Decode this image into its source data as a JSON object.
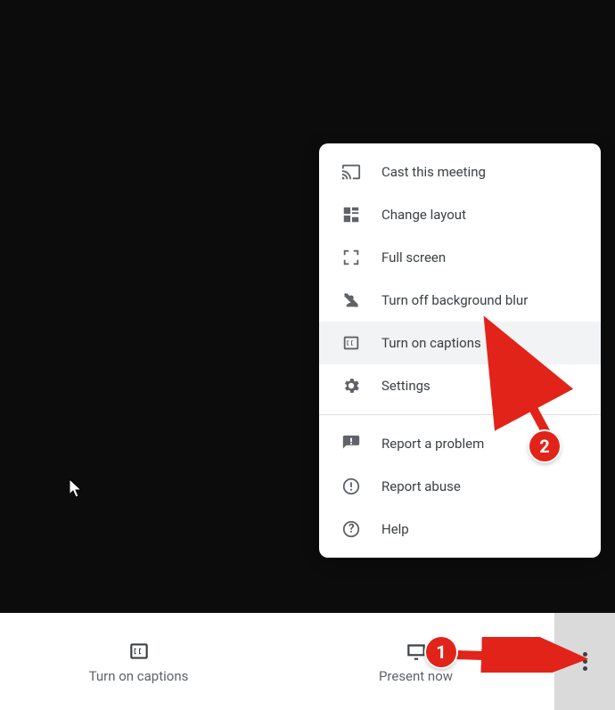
{
  "controls": {
    "captions": {
      "label": "Turn on captions"
    },
    "present": {
      "label": "Present now"
    }
  },
  "menu": {
    "items": [
      {
        "key": "cast",
        "icon": "cast-icon",
        "label": "Cast this meeting"
      },
      {
        "key": "layout",
        "icon": "layout-icon",
        "label": "Change layout"
      },
      {
        "key": "full",
        "icon": "fullscreen-icon",
        "label": "Full screen"
      },
      {
        "key": "blur",
        "icon": "blur-icon",
        "label": "Turn off background blur"
      },
      {
        "key": "captions",
        "icon": "cc-icon",
        "label": "Turn on captions"
      },
      {
        "key": "settings",
        "icon": "settings-icon",
        "label": "Settings"
      }
    ],
    "items2": [
      {
        "key": "report",
        "icon": "feedback-icon",
        "label": "Report a problem"
      },
      {
        "key": "abuse",
        "icon": "report-abuse-icon",
        "label": "Report abuse"
      },
      {
        "key": "help",
        "icon": "help-icon",
        "label": "Help"
      }
    ]
  },
  "annotations": {
    "step1": "1",
    "step2": "2"
  }
}
